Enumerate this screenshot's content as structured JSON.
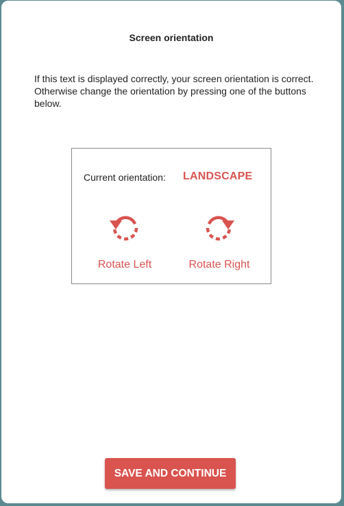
{
  "dialog": {
    "title": "Screen orientation",
    "description_line1": "If this text is displayed correctly, your screen orientation is correct.",
    "description_line2": "Otherwise change the orientation by pressing one of the buttons below."
  },
  "orientation": {
    "current_label": "Current orientation:",
    "current_value": "LANDSCAPE"
  },
  "rotate_left": {
    "label": "Rotate Left",
    "icon": "rotate-left-icon"
  },
  "rotate_right": {
    "label": "Rotate Right",
    "icon": "rotate-right-icon"
  },
  "actions": {
    "save_label": "SAVE AND CONTINUE"
  },
  "colors": {
    "accent": "#d9534f",
    "background": "#5a8a90",
    "dialog": "#ffffff",
    "text": "#222222"
  }
}
